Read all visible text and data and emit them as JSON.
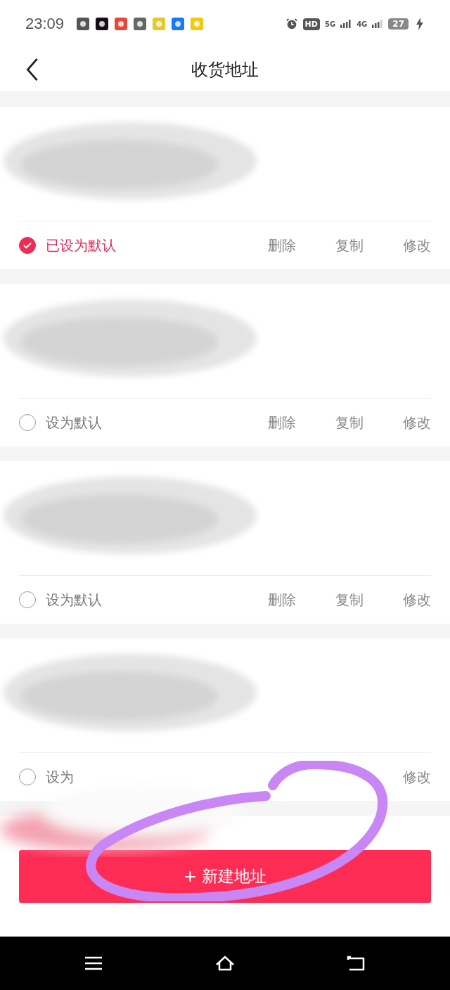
{
  "status_bar": {
    "time": "23:09",
    "hd": "HD",
    "net1": "5G",
    "net2": "4G",
    "battery": "27"
  },
  "header": {
    "title": "收货地址"
  },
  "addresses": [
    {
      "address": {
        "kind": "redacted"
      },
      "is_default": true,
      "default_label": "已设为默认",
      "actions": {
        "delete": "删除",
        "copy": "复制",
        "edit": "修改"
      }
    },
    {
      "address": {
        "kind": "redacted"
      },
      "is_default": false,
      "default_label": "设为默认",
      "actions": {
        "delete": "删除",
        "copy": "复制",
        "edit": "修改"
      }
    },
    {
      "address": {
        "kind": "redacted"
      },
      "is_default": false,
      "default_label": "设为默认",
      "actions": {
        "delete": "删除",
        "copy": "复制",
        "edit": "修改"
      }
    },
    {
      "address": {
        "kind": "redacted"
      },
      "is_default": false,
      "default_label": "设为",
      "actions": {
        "edit": "修改"
      }
    }
  ],
  "new_button": {
    "label": "+ 新建地址"
  },
  "annotations": [
    {
      "kind": "smudge"
    },
    {
      "kind": "circle"
    }
  ]
}
